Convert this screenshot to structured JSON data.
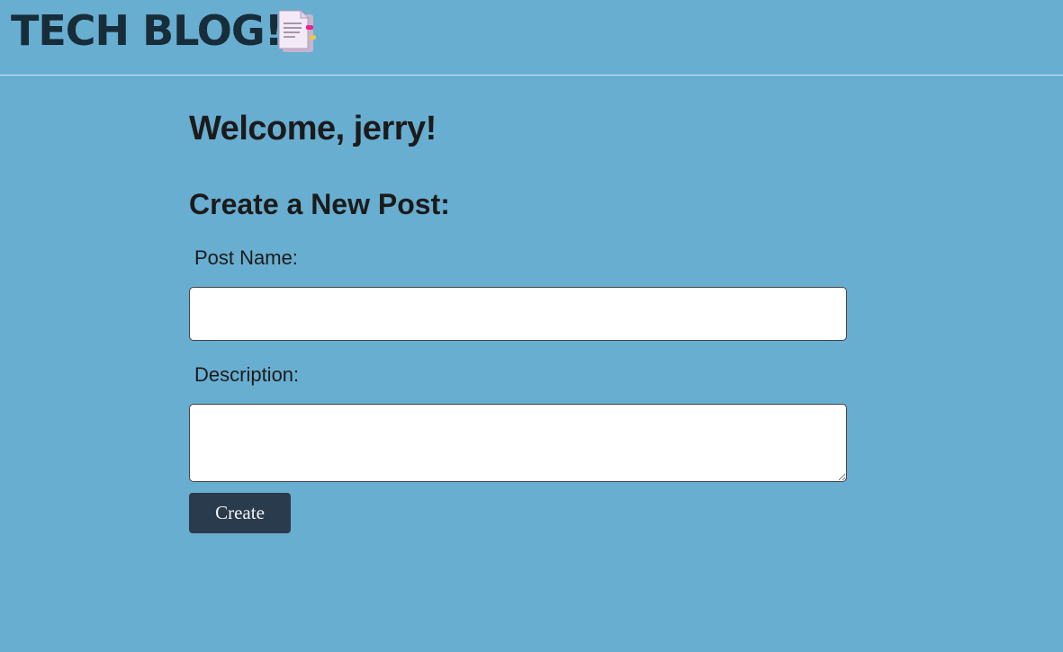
{
  "header": {
    "title": "TECH BLOG!",
    "icon": "document-icon"
  },
  "main": {
    "welcome": "Welcome, jerry!",
    "form_title": "Create a New Post:",
    "post_name_label": "Post Name:",
    "post_name_value": "",
    "description_label": "Description:",
    "description_value": "",
    "create_label": "Create"
  },
  "colors": {
    "background": "#68aed0",
    "title": "#172d3a",
    "button": "#2b3b4e"
  }
}
